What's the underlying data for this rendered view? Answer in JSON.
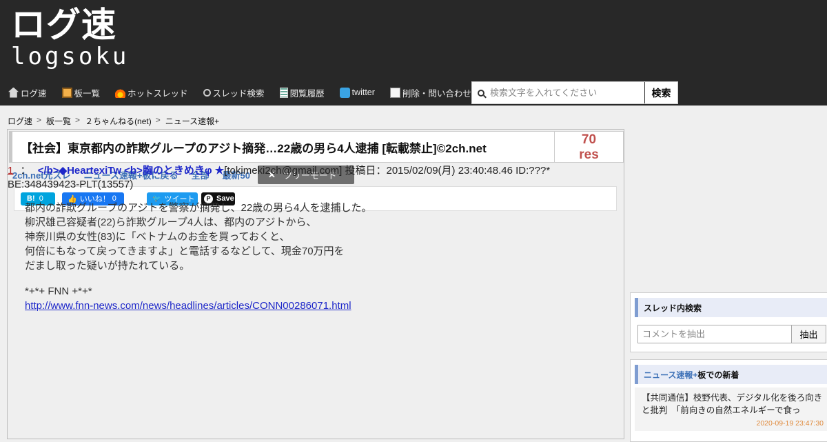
{
  "header": {
    "logo_jp": "ログ速",
    "logo_en": "logsoku"
  },
  "nav": {
    "items": [
      {
        "label": "ログ速",
        "icon": "home-icon"
      },
      {
        "label": "板一覧",
        "icon": "board-icon"
      },
      {
        "label": "ホットスレッド",
        "icon": "fire-icon"
      },
      {
        "label": "スレッド検索",
        "icon": "search-icon"
      },
      {
        "label": "閲覧履歴",
        "icon": "history-icon"
      },
      {
        "label": "twitter",
        "icon": "twitter-icon"
      },
      {
        "label": "削除・問い合わせ",
        "icon": "mail-icon"
      }
    ],
    "search_placeholder": "検索文字を入れてください",
    "search_button": "検索"
  },
  "breadcrumb": [
    "ログ速",
    "板一覧",
    "２ちゃんねる(net)",
    "ニュース速報+"
  ],
  "thread": {
    "title": "【社会】東京都内の詐欺グループのアジト摘発…22歳の男ら4人逮捕 [転載禁止]©2ch.net",
    "res_count": "70",
    "res_label": "res",
    "links": [
      "2ch.net元スレ",
      "ニュース速報+板に戻る",
      "全部",
      "最新50"
    ],
    "tree_mode": "ツリーモード"
  },
  "share": {
    "hatena_label": "B!",
    "hatena_count": "0",
    "fb_label": "いいね！",
    "fb_count": "0",
    "tweet_label": "ツイート",
    "pin_label": "Save"
  },
  "post": {
    "number": "1",
    "separator": "：",
    "name": "</b>◆HeartexiTw <b>胸のときめきφ ★",
    "email": "[tokimeki2ch@gmail.com]",
    "date_label": "投稿日：2015/02/09(月) 23:40:48.46 ID:???*",
    "be": "BE:348439423-PLT(13557)",
    "body_lines": [
      "都内の詐欺グループのアジトを警察が摘発し、22歳の男ら4人を逮捕した。",
      "柳沢雄己容疑者(22)ら詐欺グループ4人は、都内のアジトから、",
      "神奈川県の女性(83)に「ベトナムのお金を買っておくと、",
      "何倍にもなって戻ってきますよ」と電話するなどして、現金70万円を",
      "だまし取った疑いが持たれている。"
    ],
    "source": "*+*+ FNN +*+*",
    "link": "http://www.fnn-news.com/news/headlines/articles/CONN00286071.html"
  },
  "sidebar": {
    "search_title": "スレッド内検索",
    "search_placeholder": "コメントを抽出",
    "search_button": "抽出",
    "new_board": "ニュース速報+",
    "new_suffix": "板での新着",
    "new_items": [
      {
        "title": "【共同通信】枝野代表、デジタル化を後ろ向きと批判　「前向きの自然エネルギーで食っ",
        "date": "2020-09-19 23:47:30"
      }
    ]
  },
  "colors": {
    "header_bg": "#282828",
    "res_count": "#c0504d",
    "link_blue": "#3b6fb6",
    "post_name": "#1d27c9"
  }
}
